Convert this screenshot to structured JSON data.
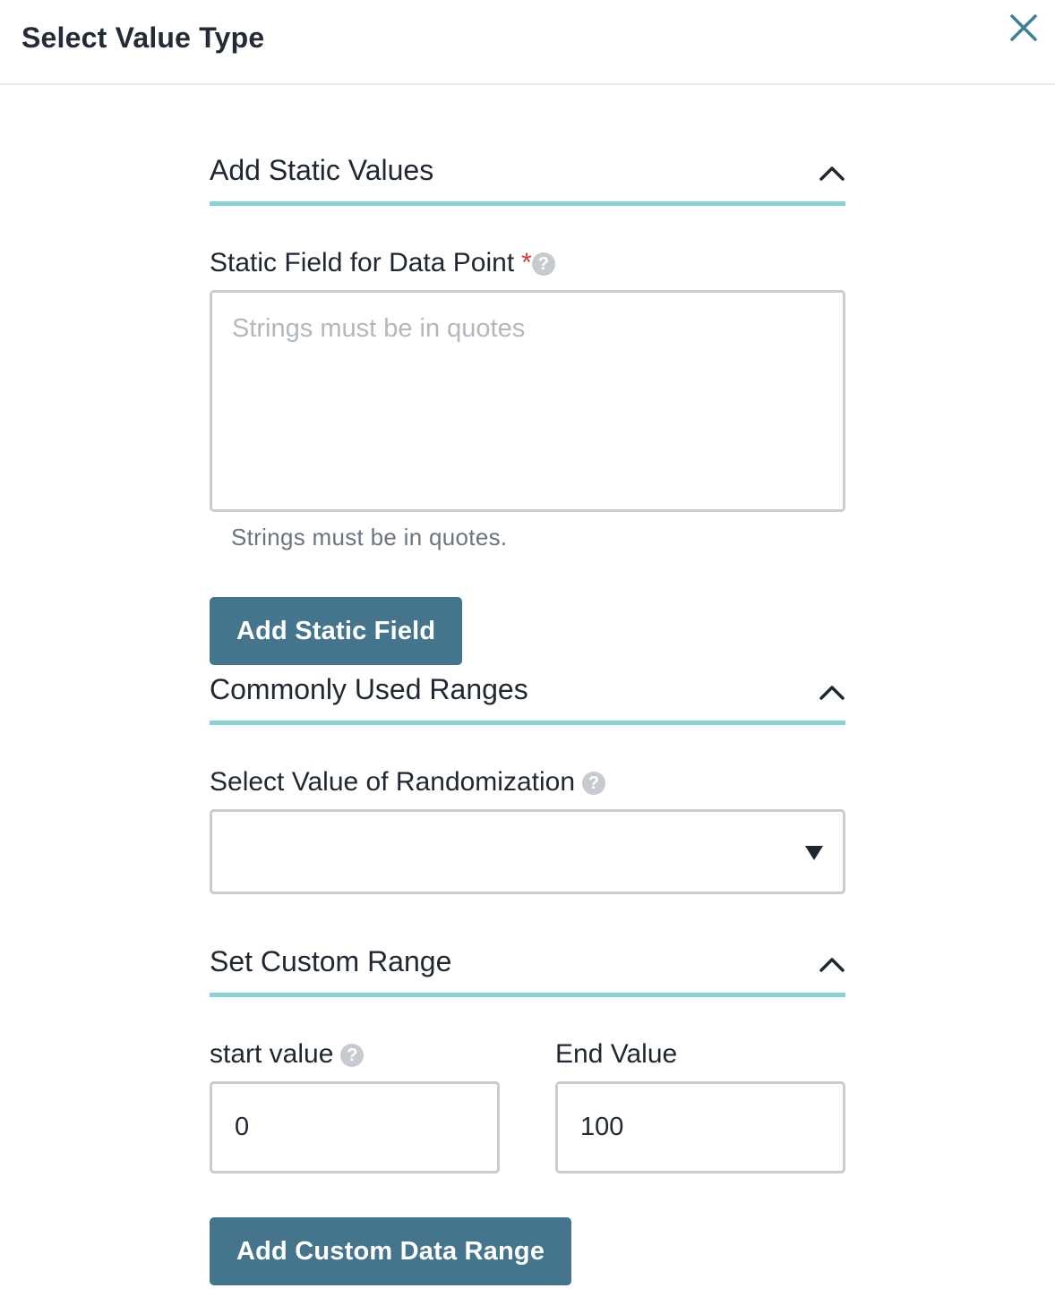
{
  "header": {
    "title": "Select Value Type",
    "close_icon": "close-icon"
  },
  "sections": {
    "static_values": {
      "title": "Add Static Values",
      "field_label": "Static Field for Data Point",
      "required_mark": "*",
      "placeholder": "Strings must be in quotes",
      "value": "",
      "hint": "Strings must be in quotes.",
      "button_label": "Add Static Field"
    },
    "common_ranges": {
      "title": "Commonly Used Ranges",
      "field_label": "Select Value of Randomization",
      "selected_value": ""
    },
    "custom_range": {
      "title": "Set Custom Range",
      "start_label": "start value",
      "start_value": "0",
      "end_label": "End Value",
      "end_value": "100",
      "button_label": "Add Custom Data Range"
    }
  },
  "help_icon_glyph": "?",
  "colors": {
    "accent_underline": "#8fd0d2",
    "button_bg": "#45758c",
    "close_icon": "#3f7f96",
    "required": "#d6383a"
  }
}
